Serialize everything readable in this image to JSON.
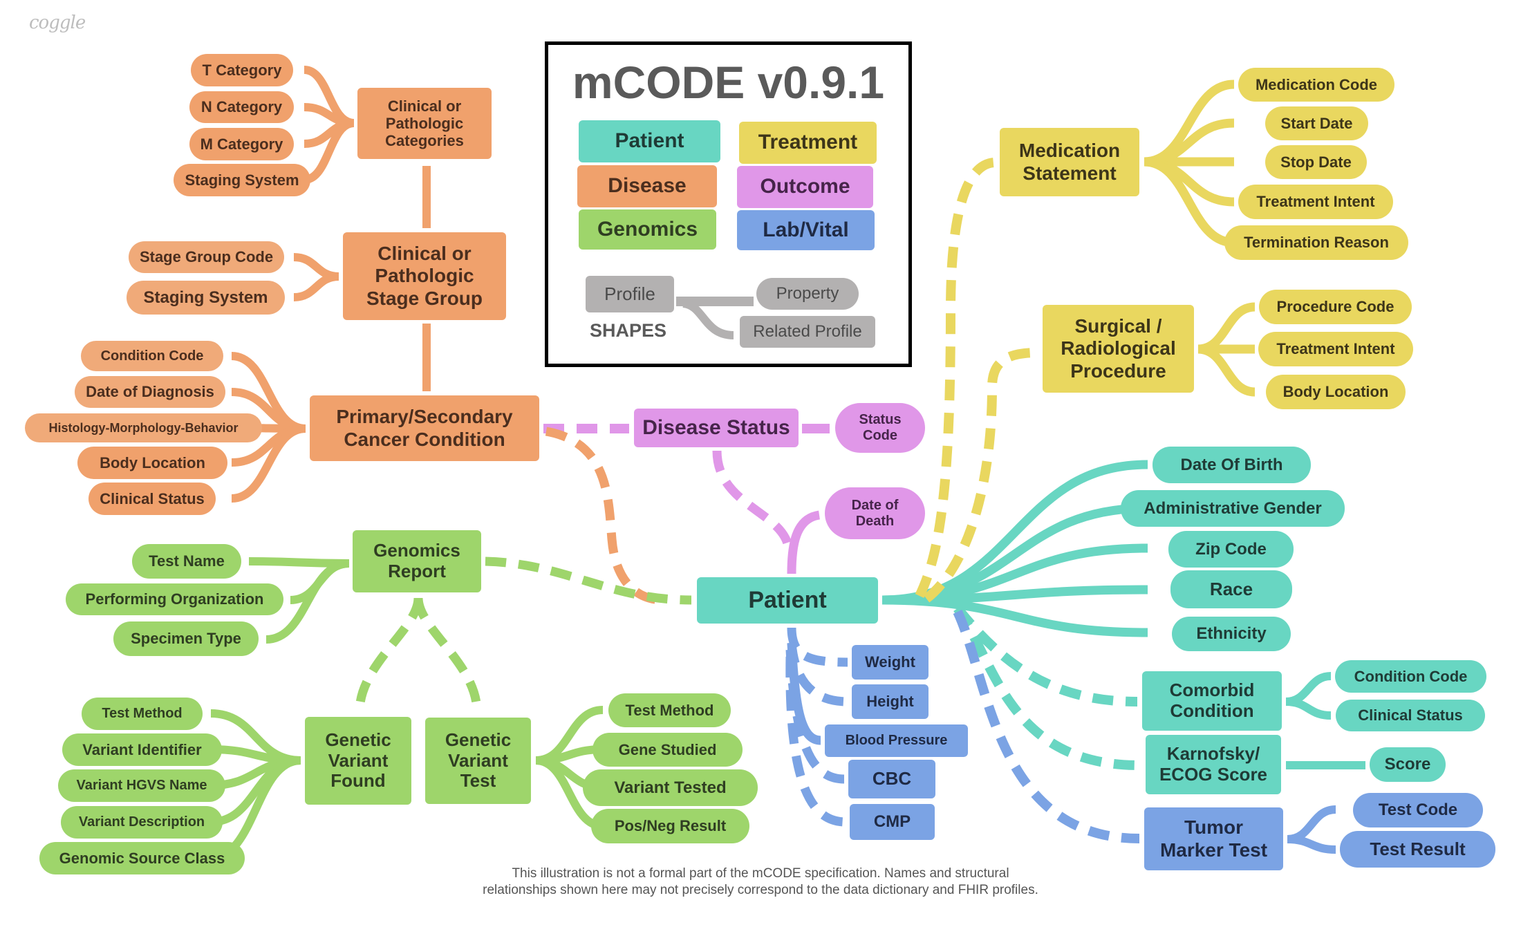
{
  "logo": "coggle",
  "legend": {
    "title": "mCODE v0.9.1",
    "categories": [
      {
        "label": "Patient",
        "color": "#68D6C2"
      },
      {
        "label": "Treatment",
        "color": "#E9D75F"
      },
      {
        "label": "Disease",
        "color": "#F0A16C"
      },
      {
        "label": "Outcome",
        "color": "#E097E8"
      },
      {
        "label": "Genomics",
        "color": "#9ED56B"
      },
      {
        "label": "Lab/Vital",
        "color": "#7BA3E4"
      }
    ],
    "shapes": {
      "profile": "Profile",
      "property": "Property",
      "related_profile": "Related Profile",
      "label": "SHAPES"
    }
  },
  "nodes": {
    "patient": "Patient",
    "disease_status": "Disease Status",
    "status_code": "Status\nCode",
    "date_of_death": "Date of\nDeath",
    "primary_cancer": "Primary/Secondary\nCancer Condition",
    "stage_group": "Clinical or\nPathologic\nStage Group",
    "categories": "Clinical or\nPathologic\nCategories",
    "genomics_report": "Genomics\nReport",
    "variant_found": "Genetic\nVariant\nFound",
    "variant_test": "Genetic\nVariant\nTest",
    "medication": "Medication\nStatement",
    "procedure": "Surgical /\nRadiological\nProcedure",
    "comorbid": "Comorbid\nCondition",
    "karnofsky": "Karnofsky/\nECOG Score",
    "tumor_marker": "Tumor\nMarker Test"
  },
  "properties": {
    "categories": [
      "T Category",
      "N Category",
      "M Category",
      "Staging System"
    ],
    "stage_group": [
      "Stage Group Code",
      "Staging System"
    ],
    "primary_cancer": [
      "Condition Code",
      "Date of Diagnosis",
      "Histology-Morphology-Behavior",
      "Body Location",
      "Clinical Status"
    ],
    "genomics_report": [
      "Test Name",
      "Performing Organization",
      "Specimen Type"
    ],
    "variant_found": [
      "Test Method",
      "Variant Identifier",
      "Variant HGVS Name",
      "Variant Description",
      "Genomic Source Class"
    ],
    "variant_test": [
      "Test Method",
      "Gene Studied",
      "Variant Tested",
      "Pos/Neg Result"
    ],
    "medication": [
      "Medication Code",
      "Start Date",
      "Stop Date",
      "Treatment Intent",
      "Termination Reason"
    ],
    "procedure": [
      "Procedure Code",
      "Treatment Intent",
      "Body Location"
    ],
    "patient": [
      "Date Of Birth",
      "Administrative Gender",
      "Zip Code",
      "Race",
      "Ethnicity"
    ],
    "comorbid": [
      "Condition Code",
      "Clinical Status"
    ],
    "karnofsky": [
      "Score"
    ],
    "tumor_marker": [
      "Test Code",
      "Test Result"
    ],
    "lab_vital": [
      "Weight",
      "Height",
      "Blood Pressure",
      "CBC",
      "CMP"
    ]
  },
  "footer": {
    "line1": "This illustration is not a formal part of the mCODE specification. Names and structural",
    "line2": "relationships shown here may not precisely correspond to the data dictionary and FHIR profiles."
  }
}
